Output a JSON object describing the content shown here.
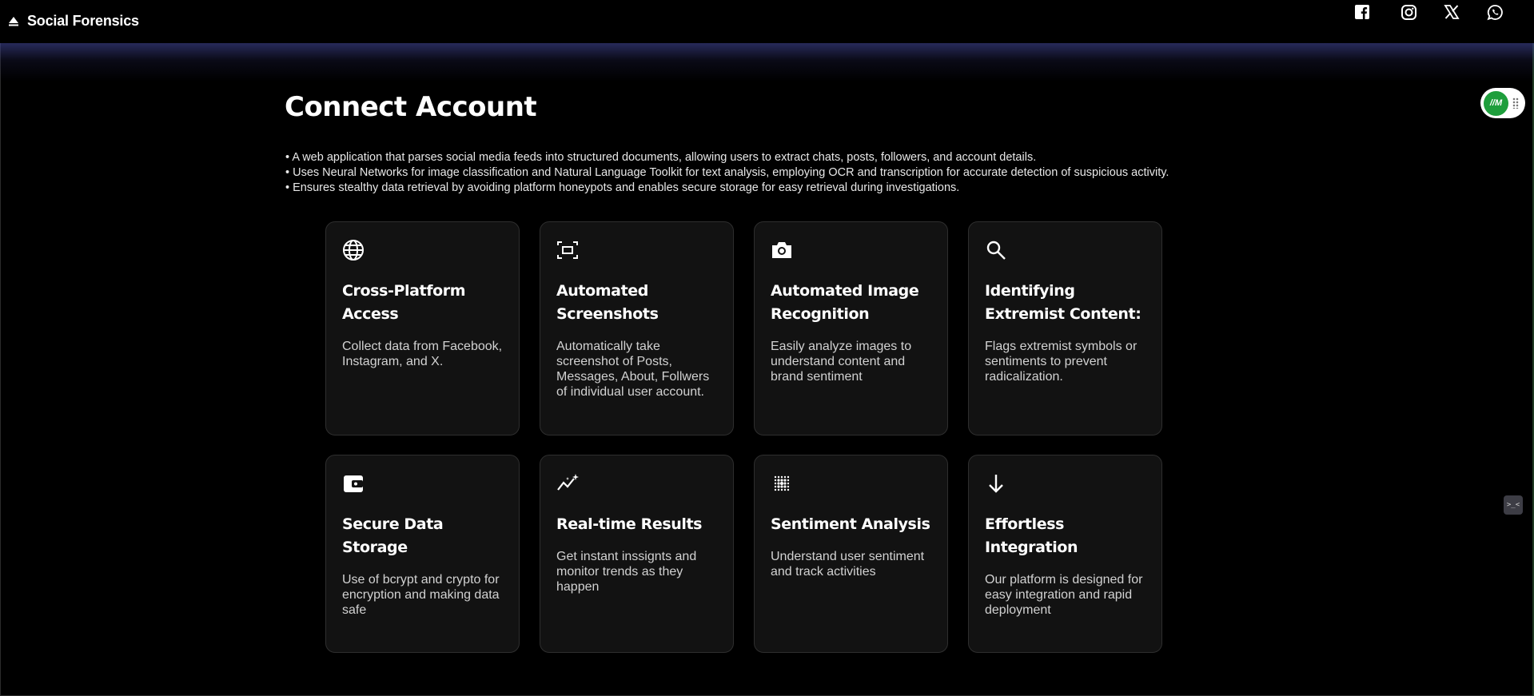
{
  "header": {
    "brand_title": "Social Forensics",
    "brand_icon": "eject-triangle-icon",
    "social_links": [
      {
        "name": "Facebook",
        "icon": "facebook-icon"
      },
      {
        "name": "Instagram",
        "icon": "instagram-icon"
      },
      {
        "name": "X",
        "icon": "x-icon"
      },
      {
        "name": "WhatsApp",
        "icon": "whatsapp-icon"
      }
    ]
  },
  "main": {
    "title": "Connect Account",
    "bullets": [
      "A web application that parses social media feeds into structured documents, allowing users to extract chats, posts, followers, and account details.",
      "Uses Neural Networks for image classification and Natural Language Toolkit for text analysis, employing OCR and transcription for accurate detection of suspicious activity.",
      "Ensures stealthy data retrieval by avoiding platform honeypots and enables secure storage for easy retrieval during investigations."
    ],
    "features": [
      {
        "icon": "globe-icon",
        "title": "Cross-Platform Access",
        "description": "Collect data from Facebook, Instagram, and X."
      },
      {
        "icon": "screenshot-frame-icon",
        "title": "Automated Screenshots",
        "description": "Automatically take screenshot of Posts, Messages, About, Follwers of individual user account."
      },
      {
        "icon": "camera-icon",
        "title": "Automated Image Recognition",
        "description": "Easily analyze images to understand content and brand sentiment"
      },
      {
        "icon": "search-icon",
        "title": "Identifying Extremist Content:",
        "description": "Flags extremist symbols or sentiments to prevent radicalization."
      },
      {
        "icon": "wallet-icon",
        "title": "Secure Data Storage",
        "description": "Use of bcrypt and crypto for encryption and making data safe"
      },
      {
        "icon": "trend-sparkle-icon",
        "title": "Real-time Results",
        "description": "Get instant inssignts and monitor trends as they happen"
      },
      {
        "icon": "dot-grid-icon",
        "title": "Sentiment Analysis",
        "description": "Understand user sentiment and track activities"
      },
      {
        "icon": "arrow-down-icon",
        "title": "Effortless Integration",
        "description": "Our platform is designed for easy integration and rapid deployment"
      }
    ]
  },
  "widgets": {
    "toggle_logo_text": "//M",
    "side_badge_text": ">_<"
  },
  "colors": {
    "background": "#000000",
    "card_background": "#121212",
    "card_border": "#2e2e2e",
    "header_glow": "#3c418c",
    "toggle_green": "#1e9e3c"
  }
}
